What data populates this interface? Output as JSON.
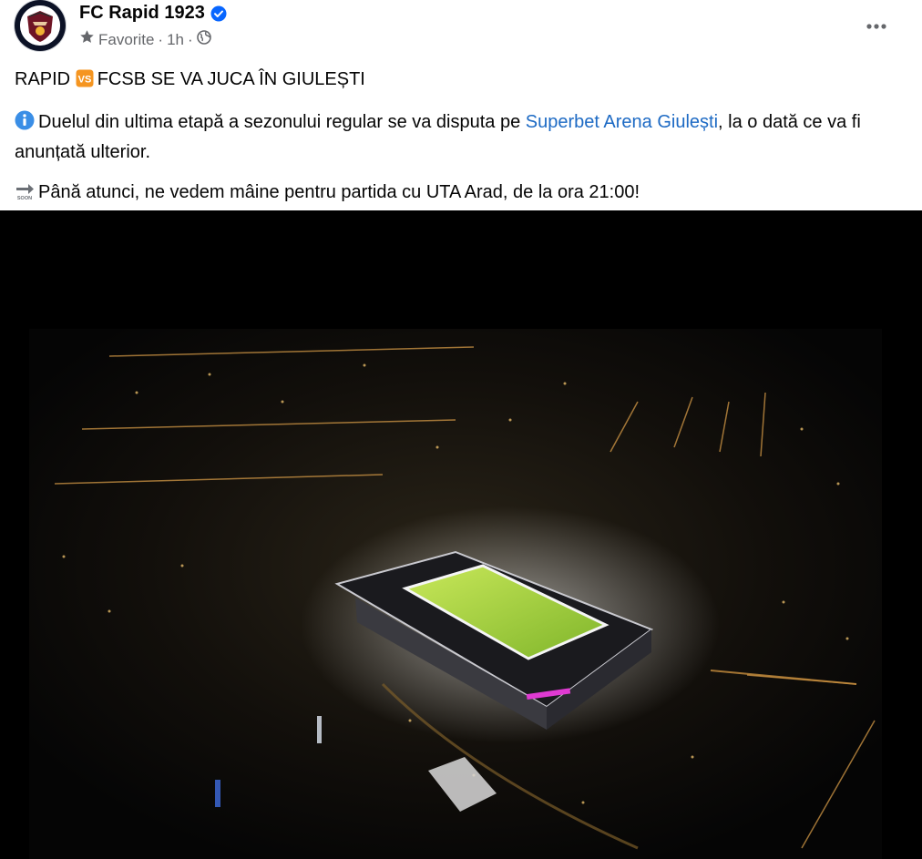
{
  "post": {
    "page_name": "FC Rapid 1923",
    "meta": {
      "audience_label": "Favorite",
      "separator": "·",
      "time": "1h",
      "separator2": "·"
    },
    "icons": {
      "avatar": "rapid-crest-icon",
      "verified": "verified-badge-icon",
      "favorite": "star-icon",
      "privacy": "globe-icon",
      "more": "more-options-icon",
      "info": "info-emoji-icon",
      "vs": "vs-emoji-icon",
      "soon": "soon-arrow-emoji-icon"
    },
    "text": {
      "line1_a": "RAPID",
      "line1_b": "FCSB SE VA JUCA ÎN GIULEȘTI",
      "line2_a": "Duelul din ultima etapă a sezonului regular se va disputa pe",
      "line2_link": "Superbet Arena Giulești",
      "line2_b": ", la o dată ce va fi anunțată ulterior.",
      "line3": "Până atunci, ne vedem mâine pentru partida cu UTA Arad, de la ora 21:00!"
    },
    "colors": {
      "link": "#1d6ac4",
      "secondary_text": "#65676b",
      "verified": "#0866ff",
      "vs_badge": "#f59520",
      "info_badge": "#3a8ee6"
    },
    "media": {
      "type": "photo",
      "subject": "stadium-aerial-night-photo"
    }
  }
}
